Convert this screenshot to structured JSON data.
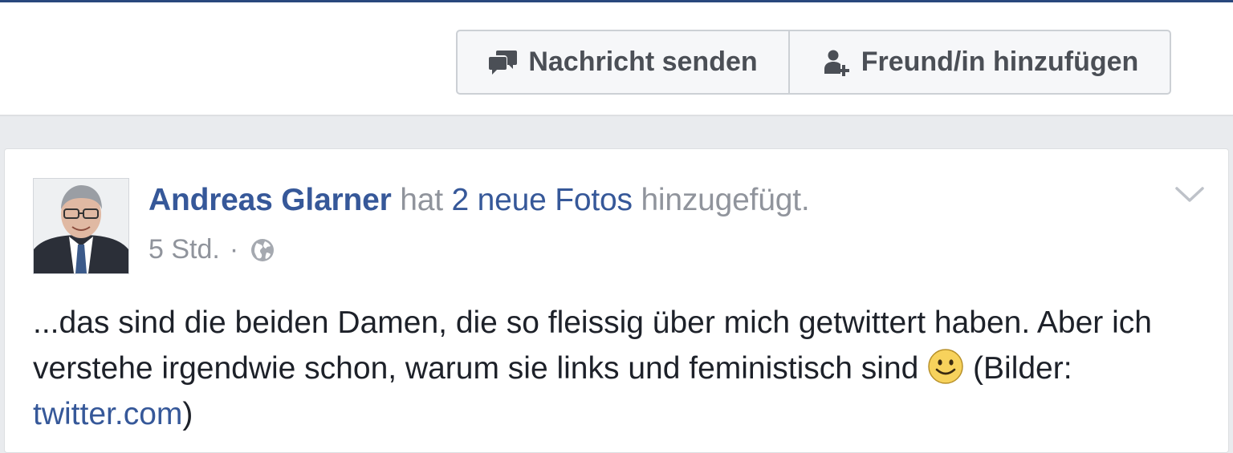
{
  "header": {
    "actions": {
      "message_label": "Nachricht senden",
      "message_icon": "message-icon",
      "add_friend_label": "Freund/in hinzufügen",
      "add_friend_icon": "add-friend-icon"
    }
  },
  "post": {
    "author": "Andreas Glarner",
    "action_prefix": "hat",
    "action_object": "2 neue Fotos",
    "action_suffix": "hinzugefügt.",
    "timestamp": "5 Std.",
    "separator": "·",
    "privacy_icon": "globe-icon",
    "menu_icon": "chevron-down-icon",
    "body": {
      "text_before_emoji": "...das sind die beiden Damen, die so fleissig über mich getwittert haben. Aber ich verstehe irgendwie schon, warum sie links und feministisch sind",
      "emoji": "smiley-emoji",
      "text_after_emoji": "(Bilder:",
      "link": "twitter.com",
      "closing": ")"
    }
  },
  "colors": {
    "brand_blue": "#365899",
    "top_rule": "#29487d",
    "muted_text": "#90949c",
    "body_text": "#1d2129",
    "button_text": "#4b4f56",
    "page_bg": "#e9ebee"
  }
}
